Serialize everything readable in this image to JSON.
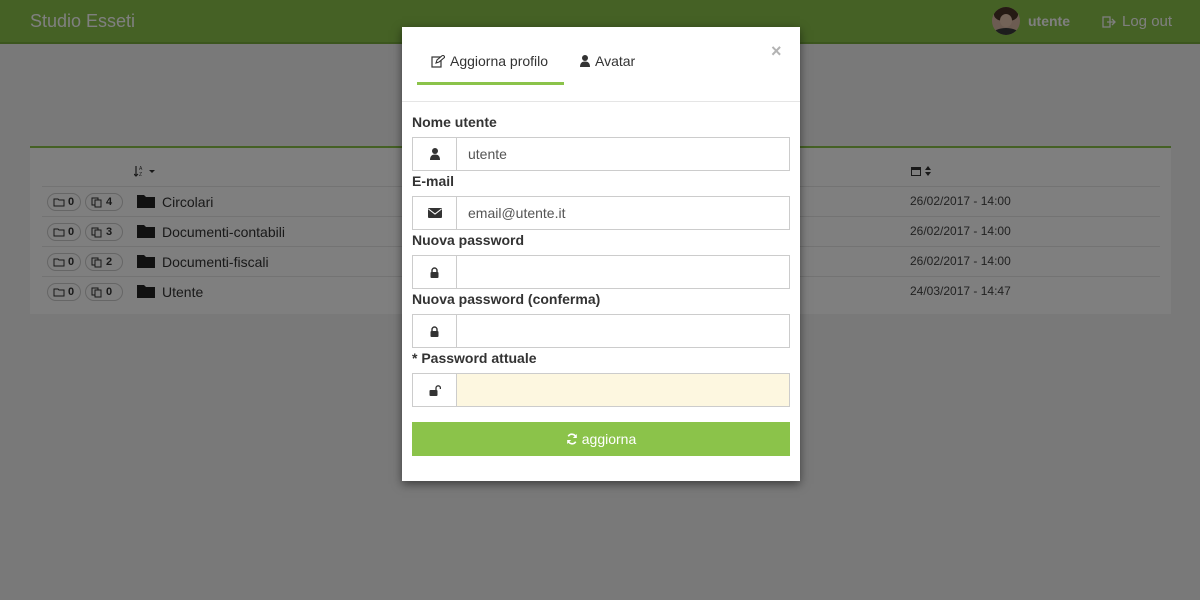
{
  "navbar": {
    "brand": "Studio Esseti",
    "user_name": "utente",
    "logout_label": "Log out"
  },
  "file_list": {
    "rows": [
      {
        "folders": "0",
        "files": "4",
        "name": "Circolari",
        "date": "26/02/2017 - 14:00"
      },
      {
        "folders": "0",
        "files": "3",
        "name": "Documenti-contabili",
        "date": "26/02/2017 - 14:00"
      },
      {
        "folders": "0",
        "files": "2",
        "name": "Documenti-fiscali",
        "date": "26/02/2017 - 14:00"
      },
      {
        "folders": "0",
        "files": "0",
        "name": "Utente",
        "date": "24/03/2017 - 14:47"
      }
    ]
  },
  "modal": {
    "tabs": [
      {
        "label": "Aggiorna profilo",
        "icon": "edit-icon",
        "active": true
      },
      {
        "label": "Avatar",
        "icon": "user-icon",
        "active": false
      }
    ],
    "close_label": "×",
    "fields": {
      "username": {
        "label": "Nome utente",
        "value": "utente",
        "icon": "user-icon"
      },
      "email": {
        "label": "E-mail",
        "value": "email@utente.it",
        "icon": "envelope-icon"
      },
      "new_password": {
        "label": "Nuova password",
        "value": "",
        "icon": "lock-icon"
      },
      "new_password_confirm": {
        "label": "Nuova password (conferma)",
        "value": "",
        "icon": "lock-icon"
      },
      "current_password": {
        "label": "* Password attuale",
        "value": "",
        "icon": "unlock-icon"
      }
    },
    "submit_label": "aggiorna"
  },
  "colors": {
    "accent": "#8bc34a",
    "highlight_field": "#fdf7e0"
  }
}
